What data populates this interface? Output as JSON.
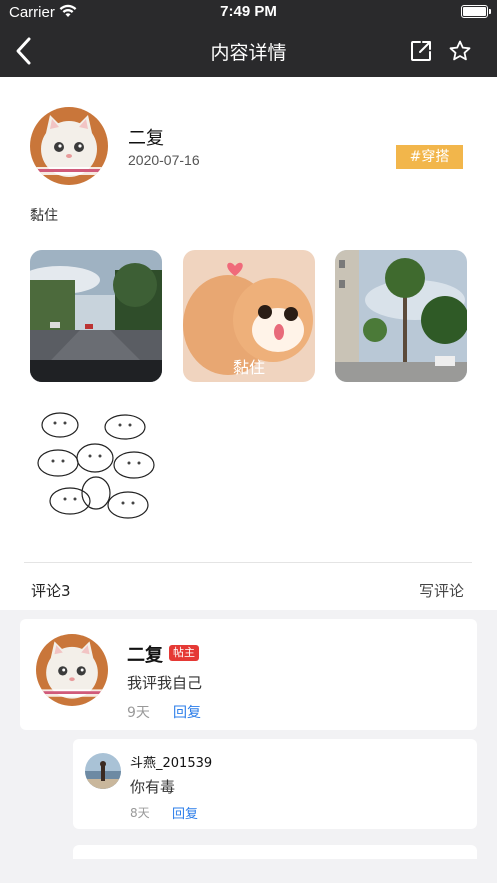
{
  "status_bar": {
    "carrier": "Carrier",
    "time": "7:49 PM"
  },
  "nav": {
    "title": "内容详情",
    "back_icon": "chevron-left-icon",
    "share_icon": "share-icon",
    "favorite_icon": "star-icon"
  },
  "post": {
    "author": "二复",
    "date": "2020-07-16",
    "tag": "#穿搭",
    "text": "黏住",
    "images": [
      {
        "name": "street-photo",
        "caption": ""
      },
      {
        "name": "cats-photo",
        "caption": "黏住"
      },
      {
        "name": "trees-photo",
        "caption": ""
      },
      {
        "name": "sketch-photo",
        "caption": ""
      }
    ]
  },
  "comments": {
    "title": "评论3",
    "write_label": "写评论",
    "items": [
      {
        "author": "二复",
        "badge": "帖主",
        "text": "我评我自己",
        "time": "9天",
        "reply_label": "回复"
      }
    ],
    "replies": [
      {
        "author": "斗燕_201539",
        "text": "你有毒",
        "time": "8天",
        "reply_label": "回复"
      }
    ]
  },
  "colors": {
    "nav_bg": "#2a2a2c",
    "tag_bg": "#f2b64b",
    "link": "#2b7de9",
    "badge": "#e53935"
  }
}
